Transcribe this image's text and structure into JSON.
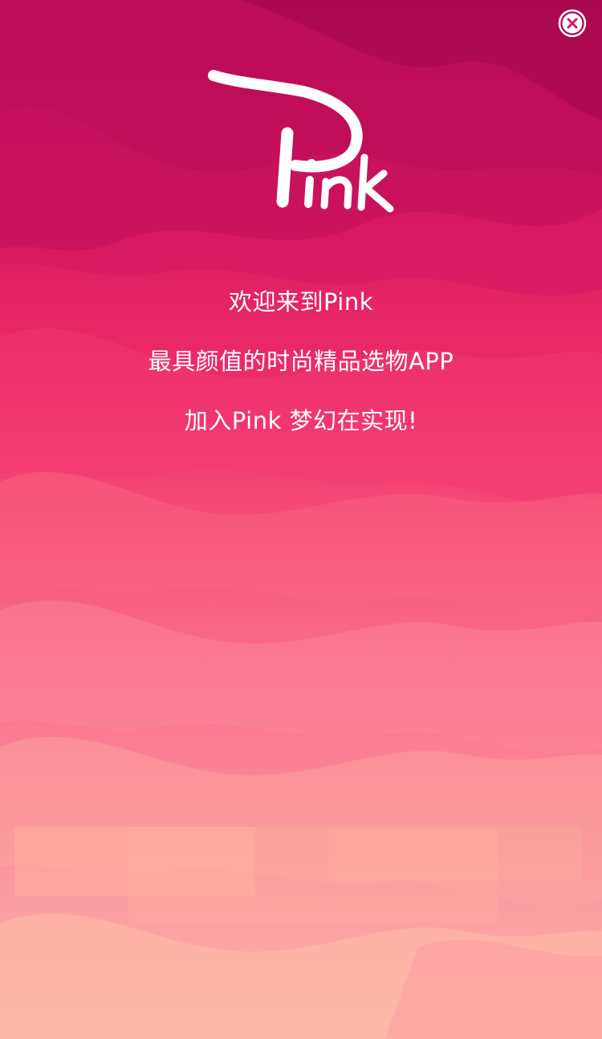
{
  "close": {
    "icon": "close-circle-icon"
  },
  "logo": {
    "text": "Pink"
  },
  "welcome": {
    "line1": "欢迎来到Pink",
    "line2": "最具颜值的时尚精品选物APP",
    "line3": "加入Pink  梦幻在实现!"
  },
  "colors": {
    "top": "#c2105a",
    "middle": "#f85a80",
    "bottom": "#fdb3a8",
    "text": "#ffffff"
  }
}
